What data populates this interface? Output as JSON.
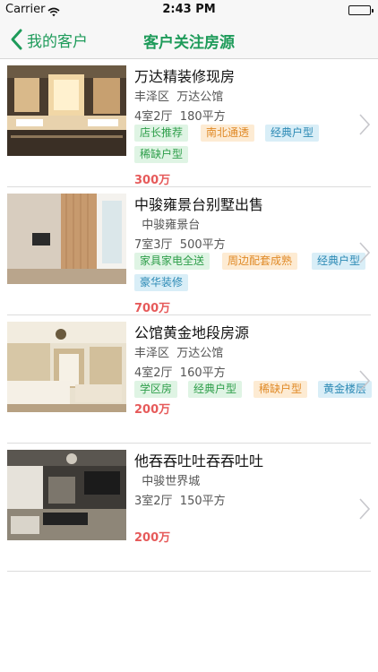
{
  "status": {
    "carrier": "Carrier",
    "time": "2:43 PM"
  },
  "nav": {
    "back_label": "我的客户",
    "title": "客户关注房源"
  },
  "listings": [
    {
      "title": "万达精装修现房",
      "location": "丰泽区  万达公馆",
      "spec": "4室2厅  180平方",
      "tags": [
        {
          "label": "店长推荐",
          "color": "green"
        },
        {
          "label": "南北通透",
          "color": "orange"
        },
        {
          "label": "经典户型",
          "color": "blue"
        },
        {
          "label": "稀缺户型",
          "color": "green"
        }
      ],
      "price": "300万"
    },
    {
      "title": "中骏雍景台别墅出售",
      "location": "  中骏雍景台",
      "spec": "7室3厅  500平方",
      "tags": [
        {
          "label": "家具家电全送",
          "color": "green"
        },
        {
          "label": "周边配套成熟",
          "color": "orange"
        },
        {
          "label": "经典户型",
          "color": "blue"
        },
        {
          "label": "豪华装修",
          "color": "blue"
        }
      ],
      "price": "700万"
    },
    {
      "title": "公馆黄金地段房源",
      "location": "丰泽区  万达公馆",
      "spec": "4室2厅  160平方",
      "tags": [
        {
          "label": "学区房",
          "color": "green"
        },
        {
          "label": "经典户型",
          "color": "green"
        },
        {
          "label": "稀缺户型",
          "color": "orange"
        },
        {
          "label": "黄金楼层",
          "color": "blue"
        }
      ],
      "price": "200万"
    },
    {
      "title": "他吞吞吐吐吞吞吐吐",
      "location": "  中骏世界城",
      "spec": "3室2厅  150平方",
      "tags": [],
      "price": "200万"
    }
  ]
}
